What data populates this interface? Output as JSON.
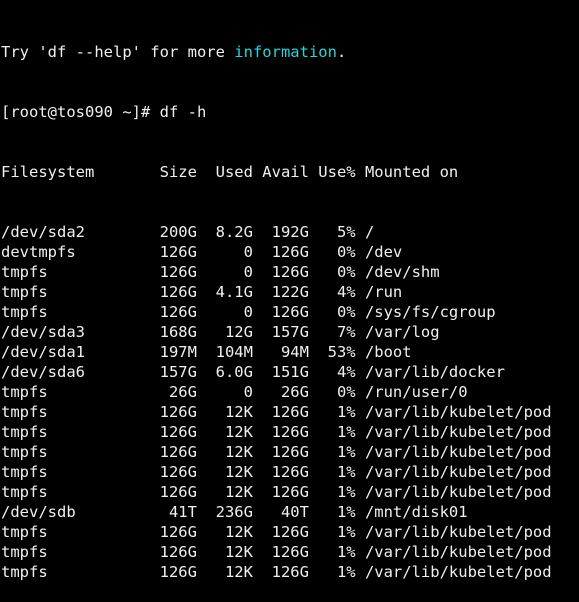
{
  "hint": {
    "prefix": "Try 'df --help' for more ",
    "highlight": "information",
    "suffix": ".",
    "highlight_color": "#2bd3d8"
  },
  "prompt": "[root@tos090 ~]# df -h",
  "header": "Filesystem       Size  Used Avail Use% Mounted on",
  "rows": [
    "/dev/sda2        200G  8.2G  192G   5% /",
    "devtmpfs         126G     0  126G   0% /dev",
    "tmpfs            126G     0  126G   0% /dev/shm",
    "tmpfs            126G  4.1G  122G   4% /run",
    "tmpfs            126G     0  126G   0% /sys/fs/cgroup",
    "/dev/sda3        168G   12G  157G   7% /var/log",
    "/dev/sda1        197M  104M   94M  53% /boot",
    "/dev/sda6        157G  6.0G  151G   4% /var/lib/docker",
    "tmpfs             26G     0   26G   0% /run/user/0",
    "tmpfs            126G   12K  126G   1% /var/lib/kubelet/pod",
    "tmpfs            126G   12K  126G   1% /var/lib/kubelet/pod",
    "tmpfs            126G   12K  126G   1% /var/lib/kubelet/pod",
    "tmpfs            126G   12K  126G   1% /var/lib/kubelet/pod",
    "tmpfs            126G   12K  126G   1% /var/lib/kubelet/pod",
    "/dev/sdb          41T  236G   40T   1% /mnt/disk01",
    "tmpfs            126G   12K  126G   1% /var/lib/kubelet/pod",
    "tmpfs            126G   12K  126G   1% /var/lib/kubelet/pod",
    "tmpfs            126G   12K  126G   1% /var/lib/kubelet/pod"
  ]
}
